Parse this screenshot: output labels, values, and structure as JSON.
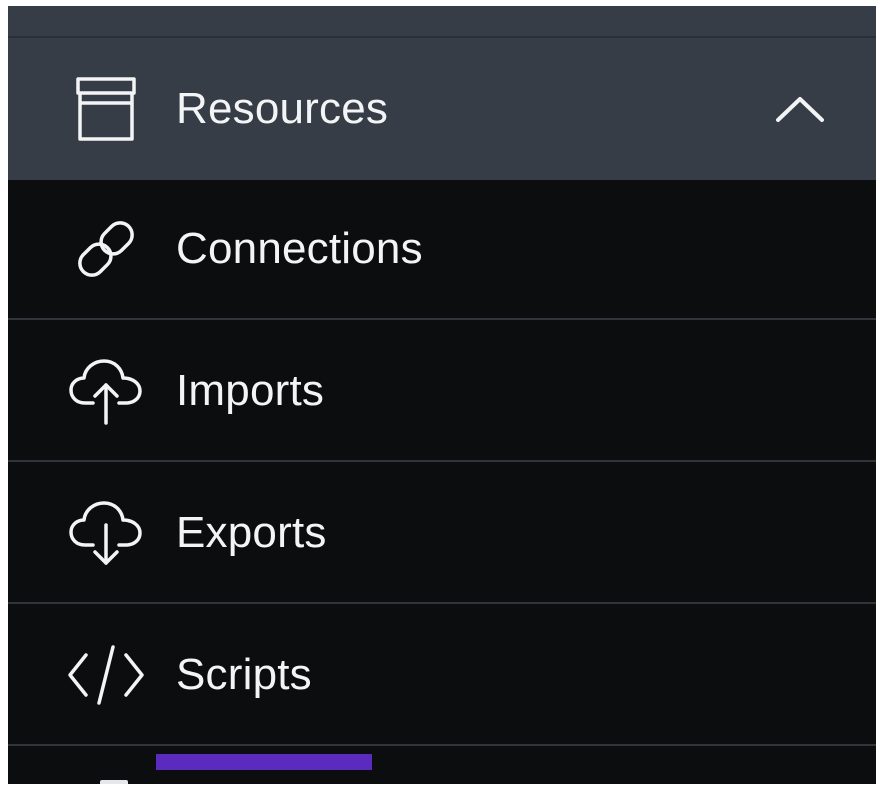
{
  "section": {
    "title": "Resources",
    "icon": "archive-box-icon",
    "toggle_icon": "chevron-up-icon",
    "expanded": true
  },
  "items": [
    {
      "label": "Connections",
      "icon": "link-icon"
    },
    {
      "label": "Imports",
      "icon": "cloud-upload-icon"
    },
    {
      "label": "Exports",
      "icon": "cloud-download-icon"
    },
    {
      "label": "Scripts",
      "icon": "code-icon"
    }
  ],
  "colors": {
    "header_bg": "#363d47",
    "item_bg": "#0c0d0f",
    "divider": "#31353b",
    "text": "#f3f4f6",
    "accent": "#5b2bbf"
  }
}
